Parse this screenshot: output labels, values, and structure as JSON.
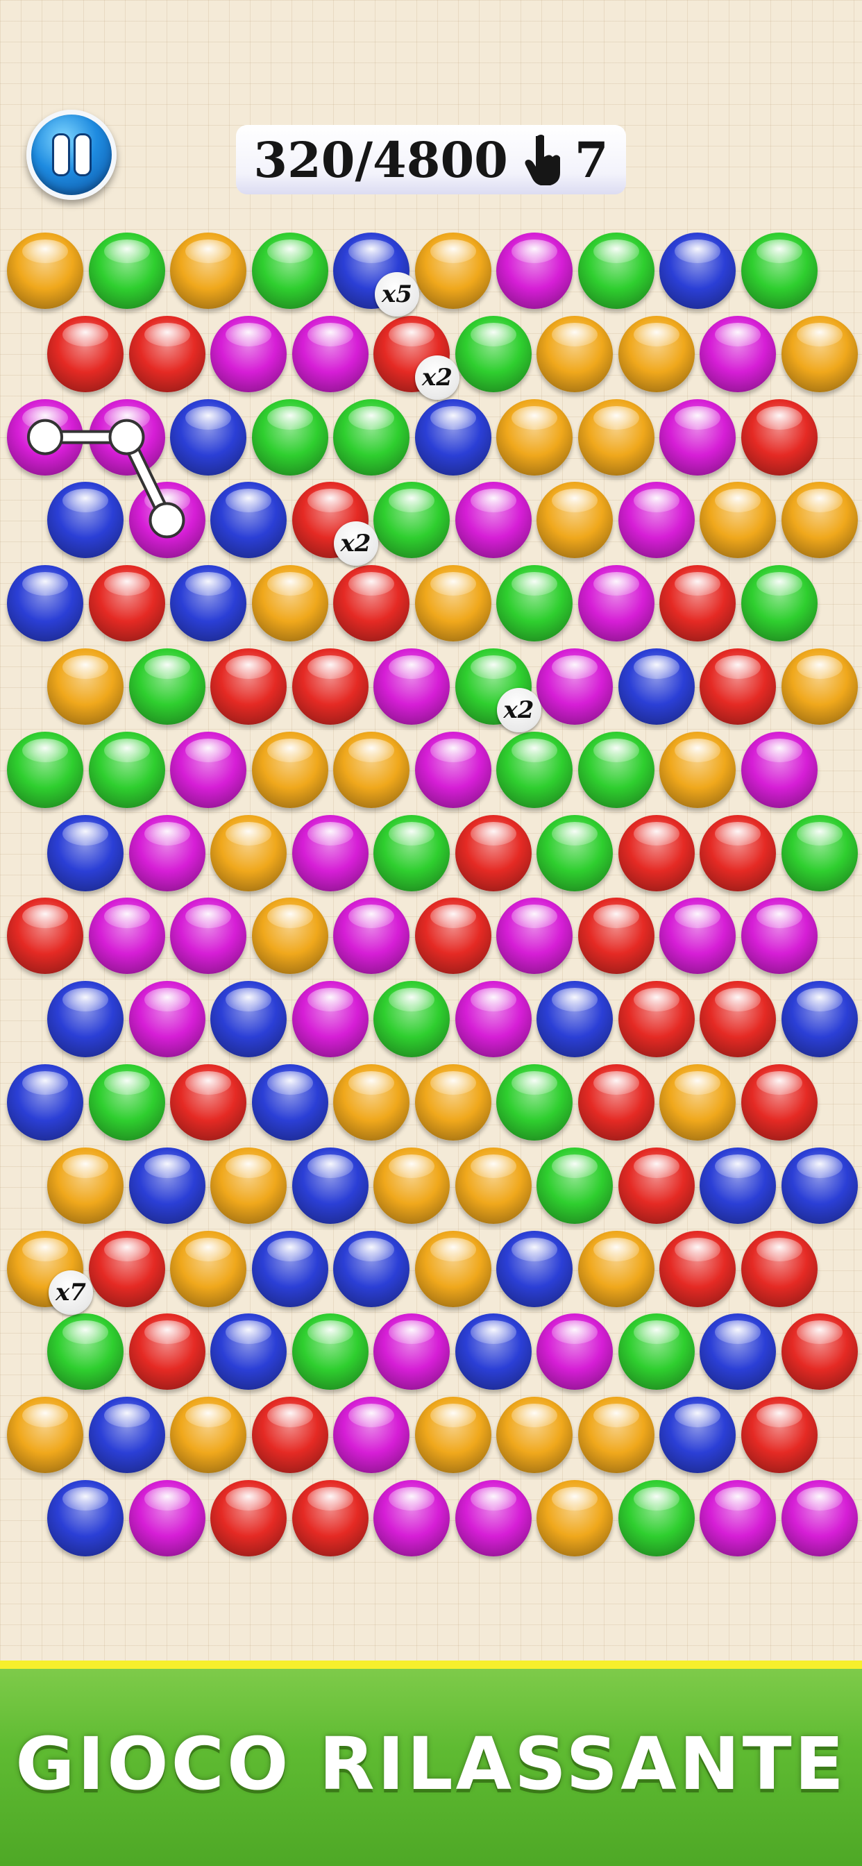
{
  "hud": {
    "score": "320/4800",
    "moves": "7",
    "pause_icon": "pause-icon",
    "moves_icon": "hand-pointer-icon"
  },
  "colors": {
    "orange": "#f0a81c",
    "green": "#2fcf2f",
    "blue": "#2b3fd6",
    "red": "#e52a24",
    "magenta": "#d61ed6",
    "path": "#ffffff",
    "banner_top": "#f6ef2c",
    "banner_green": "#5fbb32"
  },
  "board": {
    "rows": [
      [
        "orange",
        "green",
        "orange",
        "green",
        "blue",
        "orange",
        "magenta",
        "green",
        "blue",
        "green"
      ],
      [
        "red",
        "red",
        "magenta",
        "magenta",
        "red",
        "green",
        "orange",
        "orange",
        "magenta",
        "orange"
      ],
      [
        "magenta",
        "magenta",
        "blue",
        "green",
        "green",
        "blue",
        "orange",
        "orange",
        "magenta",
        "red"
      ],
      [
        "blue",
        "magenta",
        "blue",
        "red",
        "green",
        "magenta",
        "orange",
        "magenta",
        "orange",
        "orange"
      ],
      [
        "blue",
        "red",
        "blue",
        "orange",
        "red",
        "orange",
        "green",
        "magenta",
        "red",
        "green"
      ],
      [
        "orange",
        "green",
        "red",
        "red",
        "magenta",
        "green",
        "magenta",
        "blue",
        "red",
        "orange"
      ],
      [
        "green",
        "green",
        "magenta",
        "orange",
        "orange",
        "magenta",
        "green",
        "green",
        "orange",
        "magenta"
      ],
      [
        "blue",
        "magenta",
        "orange",
        "magenta",
        "green",
        "red",
        "green",
        "red",
        "red",
        "green"
      ],
      [
        "red",
        "magenta",
        "magenta",
        "orange",
        "magenta",
        "red",
        "magenta",
        "red",
        "magenta",
        "magenta"
      ],
      [
        "blue",
        "magenta",
        "blue",
        "magenta",
        "green",
        "magenta",
        "blue",
        "red",
        "red",
        "blue"
      ],
      [
        "blue",
        "green",
        "red",
        "blue",
        "orange",
        "orange",
        "green",
        "red",
        "orange",
        "red"
      ],
      [
        "orange",
        "blue",
        "orange",
        "blue",
        "orange",
        "orange",
        "green",
        "red",
        "blue",
        "blue"
      ],
      [
        "orange",
        "red",
        "orange",
        "blue",
        "blue",
        "orange",
        "blue",
        "orange",
        "red",
        "red"
      ],
      [
        "green",
        "red",
        "blue",
        "green",
        "magenta",
        "blue",
        "magenta",
        "green",
        "blue",
        "red"
      ],
      [
        "orange",
        "blue",
        "orange",
        "red",
        "magenta",
        "orange",
        "orange",
        "orange",
        "blue",
        "red"
      ],
      [
        "blue",
        "magenta",
        "red",
        "red",
        "magenta",
        "magenta",
        "orange",
        "green",
        "magenta",
        "magenta"
      ]
    ],
    "multipliers": [
      {
        "row": 0,
        "col": 4,
        "label": "x5"
      },
      {
        "row": 1,
        "col": 4,
        "label": "x2"
      },
      {
        "row": 3,
        "col": 3,
        "label": "x2"
      },
      {
        "row": 5,
        "col": 5,
        "label": "x2"
      },
      {
        "row": 12,
        "col": 0,
        "label": "x7"
      }
    ],
    "selected_path": [
      {
        "row": 2,
        "col": 0
      },
      {
        "row": 2,
        "col": 1
      },
      {
        "row": 3,
        "col": 1
      }
    ]
  },
  "banner": {
    "text": "GIOCO RILASSANTE"
  }
}
